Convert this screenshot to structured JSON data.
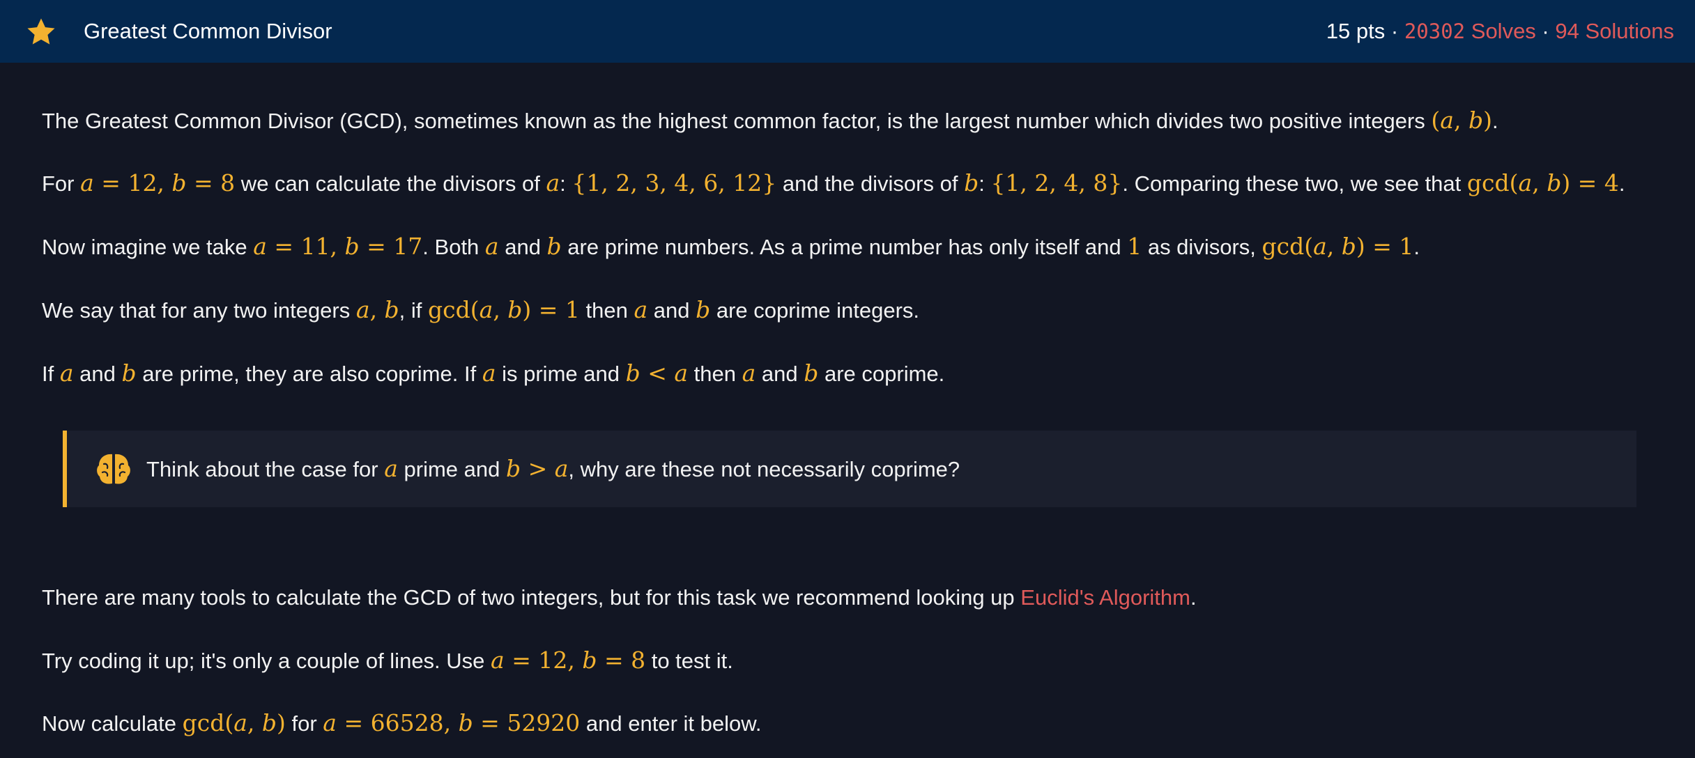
{
  "header": {
    "title": "Greatest Common Divisor",
    "pts": "15 pts",
    "sep": " · ",
    "solves_num": "20302",
    "solves_label": "Solves",
    "solutions": "94 Solutions",
    "icon": "star-icon"
  },
  "colors": {
    "header_bg": "#04284f",
    "page_bg": "#121623",
    "accent_math": "#f3b230",
    "accent_link": "#e05a5a",
    "callout_bg": "#1b1f2d"
  },
  "p1": {
    "t1": "The Greatest Common Divisor (GCD), sometimes known as the highest common factor, is the largest number which divides two positive integers ",
    "m1": "(a, b)",
    "t2": "."
  },
  "p2": {
    "t1": "For ",
    "m1": "a = 12, b = 8",
    "t2": " we can calculate the divisors of ",
    "m2": "a",
    "t3": ": ",
    "m3": "{1, 2, 3, 4, 6, 12}",
    "t4": " and the divisors of ",
    "m4": "b",
    "t5": ": ",
    "m5": "{1, 2, 4, 8}",
    "t6": ". Comparing these two, we see that ",
    "m6": "gcd(a, b) = 4",
    "t7": "."
  },
  "p3": {
    "t1": "Now imagine we take ",
    "m1": "a = 11, b = 17",
    "t2": ". Both ",
    "m2": "a",
    "t3": " and ",
    "m3": "b",
    "t4": " are prime numbers. As a prime number has only itself and ",
    "m4": "1",
    "t5": " as divisors, ",
    "m5": "gcd(a, b) = 1",
    "t6": "."
  },
  "p4": {
    "t1": "We say that for any two integers ",
    "m1": "a, b",
    "t2": ", if ",
    "m2": "gcd(a, b) = 1",
    "t3": " then ",
    "m3": "a",
    "t4": " and ",
    "m4": "b",
    "t5": " are coprime integers."
  },
  "p5": {
    "t1": "If ",
    "m1": "a",
    "t2": " and ",
    "m2": "b",
    "t3": " are prime, they are also coprime. If ",
    "m3": "a",
    "t4": " is prime and ",
    "m4": "b < a",
    "t5": " then ",
    "m5": "a",
    "t6": " and ",
    "m6": "b",
    "t7": " are coprime."
  },
  "callout": {
    "icon": "brain-icon",
    "t1": "Think about the case for ",
    "m1": "a",
    "t2": " prime and ",
    "m2": "b > a",
    "t3": ", why are these not necessarily coprime?"
  },
  "p6": {
    "t1": "There are many tools to calculate the GCD of two integers, but for this task we recommend looking up ",
    "link": "Euclid's Algorithm",
    "t2": "."
  },
  "p7": {
    "t1": "Try coding it up; it's only a couple of lines. Use ",
    "m1": "a = 12, b = 8",
    "t2": " to test it."
  },
  "p8": {
    "t1": "Now calculate ",
    "m1": "gcd(a, b)",
    "t2": " for ",
    "m2": "a = 66528, b = 52920",
    "t3": " and enter it below."
  }
}
